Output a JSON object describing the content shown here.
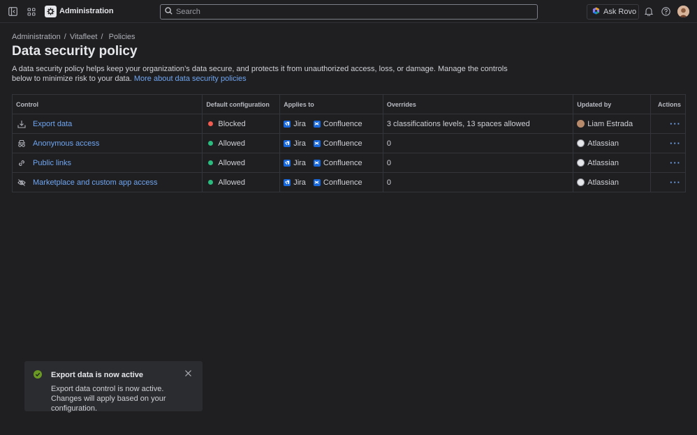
{
  "topbar": {
    "app_title": "Administration",
    "search_placeholder": "Search",
    "ask_rovo_label": "Ask Rovo"
  },
  "breadcrumb": [
    "Administration",
    "Vitafleet",
    "Policies"
  ],
  "page": {
    "title": "Data security policy",
    "description": "A data security policy helps keep your organization’s data secure, and protects it from unauthorized access, loss, or damage. Manage the controls below to minimize risk to your data.",
    "learn_more": "More about data security policies"
  },
  "table": {
    "headers": {
      "control": "Control",
      "default_configuration": "Default configuration",
      "applies_to": "Applies to",
      "overrides": "Overrides",
      "updated_by": "Updated by",
      "actions": "Actions"
    },
    "rows": [
      {
        "control": "Export data",
        "icon": "download-icon",
        "status": "Blocked",
        "status_color": "#f15b50",
        "products": [
          "Jira",
          "Confluence"
        ],
        "overrides": "3 classifications levels, 13 spaces allowed",
        "updated_by": "Liam Estrada",
        "updater_type": "person"
      },
      {
        "control": "Anonymous access",
        "icon": "incognito-icon",
        "status": "Allowed",
        "status_color": "#2abb7f",
        "products": [
          "Jira",
          "Confluence"
        ],
        "overrides": "0",
        "updated_by": "Atlassian",
        "updater_type": "org"
      },
      {
        "control": "Public links",
        "icon": "link-icon",
        "status": "Allowed",
        "status_color": "#2abb7f",
        "products": [
          "Jira",
          "Confluence"
        ],
        "overrides": "0",
        "updated_by": "Atlassian",
        "updater_type": "org"
      },
      {
        "control": "Marketplace and custom app access",
        "icon": "eye-off-icon",
        "status": "Allowed",
        "status_color": "#2abb7f",
        "products": [
          "Jira",
          "Confluence"
        ],
        "overrides": "0",
        "updated_by": "Atlassian",
        "updater_type": "org"
      }
    ],
    "actions_label": "···"
  },
  "toast": {
    "title": "Export data is now active",
    "body": "Export data control is now active. Changes will apply based on your configuration.",
    "success_color": "#6a9a23"
  }
}
